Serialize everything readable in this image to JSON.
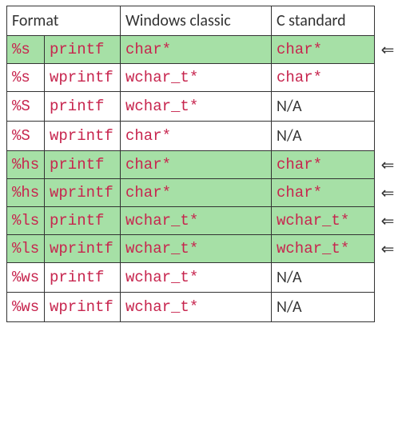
{
  "header": {
    "format": "Format",
    "windows": "Windows classic",
    "cstd": "C standard"
  },
  "rows": [
    {
      "fmt": "%s",
      "func": "printf",
      "win": "char*",
      "cstd": "char*",
      "cstd_code": true,
      "hl": true,
      "arrow": "⇐"
    },
    {
      "fmt": "%s",
      "func": "wprintf",
      "win": "wchar_t*",
      "cstd": "char*",
      "cstd_code": true,
      "hl": false,
      "arrow": ""
    },
    {
      "fmt": "%S",
      "func": "printf",
      "win": "wchar_t*",
      "cstd": "N/A",
      "cstd_code": false,
      "hl": false,
      "arrow": ""
    },
    {
      "fmt": "%S",
      "func": "wprintf",
      "win": "char*",
      "cstd": "N/A",
      "cstd_code": false,
      "hl": false,
      "arrow": ""
    },
    {
      "fmt": "%hs",
      "func": "printf",
      "win": "char*",
      "cstd": "char*",
      "cstd_code": true,
      "hl": true,
      "arrow": "⇐"
    },
    {
      "fmt": "%hs",
      "func": "wprintf",
      "win": "char*",
      "cstd": "char*",
      "cstd_code": true,
      "hl": true,
      "arrow": "⇐"
    },
    {
      "fmt": "%ls",
      "func": "printf",
      "win": "wchar_t*",
      "cstd": "wchar_t*",
      "cstd_code": true,
      "hl": true,
      "arrow": "⇐"
    },
    {
      "fmt": "%ls",
      "func": "wprintf",
      "win": "wchar_t*",
      "cstd": "wchar_t*",
      "cstd_code": true,
      "hl": true,
      "arrow": "⇐"
    },
    {
      "fmt": "%ws",
      "func": "printf",
      "win": "wchar_t*",
      "cstd": "N/A",
      "cstd_code": false,
      "hl": false,
      "arrow": ""
    },
    {
      "fmt": "%ws",
      "func": "wprintf",
      "win": "wchar_t*",
      "cstd": "N/A",
      "cstd_code": false,
      "hl": false,
      "arrow": ""
    }
  ]
}
